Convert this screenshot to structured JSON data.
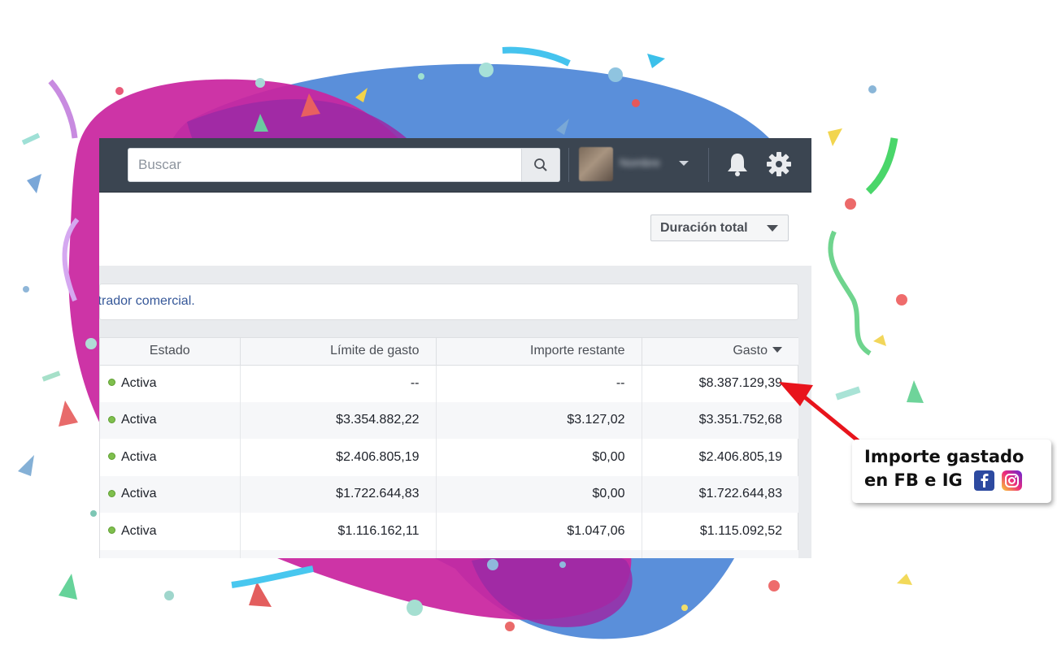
{
  "topbar": {
    "search_placeholder": "Buscar",
    "user_name": "Nombre"
  },
  "toolbar": {
    "date_range_label": "Duración total"
  },
  "notice": {
    "text": "istrador comercial."
  },
  "table": {
    "headers": {
      "estado": "Estado",
      "limite": "Límite de gasto",
      "importe": "Importe restante",
      "gasto": "Gasto"
    },
    "rows": [
      {
        "estado": "Activa",
        "limite": "--",
        "importe": "--",
        "gasto": "$8.387.129,39"
      },
      {
        "estado": "Activa",
        "limite": "$3.354.882,22",
        "importe": "$3.127,02",
        "gasto": "$3.351.752,68"
      },
      {
        "estado": "Activa",
        "limite": "$2.406.805,19",
        "importe": "$0,00",
        "gasto": "$2.406.805,19"
      },
      {
        "estado": "Activa",
        "limite": "$1.722.644,83",
        "importe": "$0,00",
        "gasto": "$1.722.644,83"
      },
      {
        "estado": "Activa",
        "limite": "$1.116.162,11",
        "importe": "$1.047,06",
        "gasto": "$1.115.092,52"
      }
    ]
  },
  "callout": {
    "line1": "Importe gastado",
    "line2": "en FB e IG"
  },
  "colors": {
    "topbar": "#3b4551",
    "status_active": "#7fbf4d",
    "link": "#365899",
    "arrow": "#e8141c",
    "blob_magenta": "#c2189e",
    "blob_blue": "#4f86d8"
  },
  "icons": [
    "search-icon",
    "chevron-down-icon",
    "bell-icon",
    "gear-icon",
    "facebook-icon",
    "instagram-icon"
  ]
}
